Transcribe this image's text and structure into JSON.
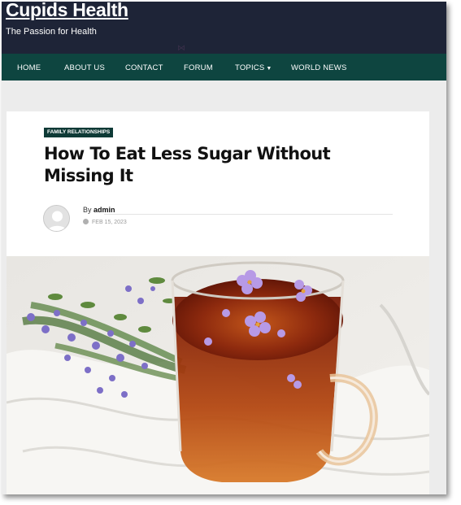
{
  "site": {
    "title": "Cupids Health",
    "tagline": "The Passion for Health"
  },
  "nav": {
    "items": [
      {
        "label": "HOME"
      },
      {
        "label": "ABOUT US"
      },
      {
        "label": "CONTACT"
      },
      {
        "label": "FORUM"
      },
      {
        "label": "TOPICS"
      },
      {
        "label": "WORLD NEWS"
      }
    ]
  },
  "article": {
    "category": "FAMILY RELATIONSHIPS",
    "title": "How To Eat Less Sugar Without Missing It",
    "by_prefix": "By",
    "author": "admin",
    "date": "FEB 15, 2023"
  },
  "colors": {
    "header": "#1e2437",
    "nav": "#0e4540",
    "badge": "#0e3a36"
  }
}
